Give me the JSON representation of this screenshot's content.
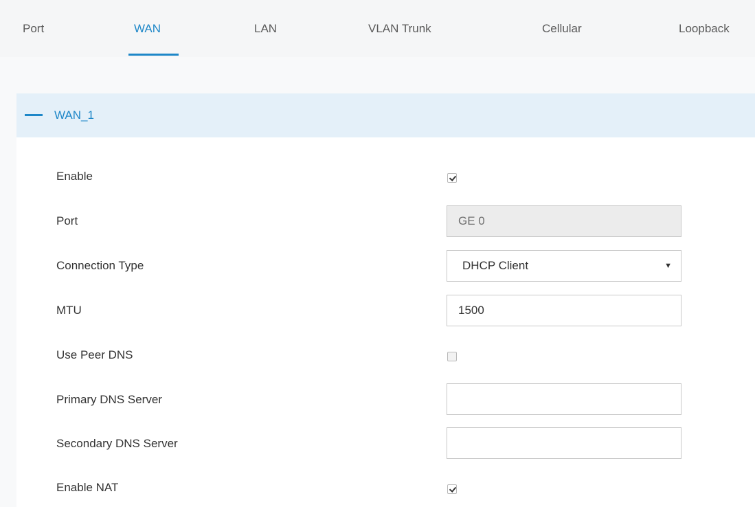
{
  "tabs": [
    {
      "label": "Port",
      "active": false
    },
    {
      "label": "WAN",
      "active": true
    },
    {
      "label": "LAN",
      "active": false
    },
    {
      "label": "VLAN Trunk",
      "active": false
    },
    {
      "label": "Cellular",
      "active": false
    },
    {
      "label": "Loopback",
      "active": false
    }
  ],
  "section": {
    "title": "WAN_1",
    "expanded": true
  },
  "form": {
    "enable": {
      "label": "Enable",
      "checked": true
    },
    "port": {
      "label": "Port",
      "value": "GE 0",
      "disabled": true
    },
    "connection_type": {
      "label": "Connection Type",
      "value": "DHCP Client",
      "arrow": "▼"
    },
    "mtu": {
      "label": "MTU",
      "value": "1500"
    },
    "use_peer_dns": {
      "label": "Use Peer DNS",
      "checked": false
    },
    "primary_dns": {
      "label": "Primary DNS Server",
      "value": ""
    },
    "secondary_dns": {
      "label": "Secondary DNS Server",
      "value": ""
    },
    "enable_nat": {
      "label": "Enable NAT",
      "checked": true
    }
  },
  "colors": {
    "accent": "#1e87c8",
    "header_bg": "#e4f0f9",
    "tabbar_bg": "#f5f6f7",
    "disabled_field_bg": "#ececec"
  }
}
